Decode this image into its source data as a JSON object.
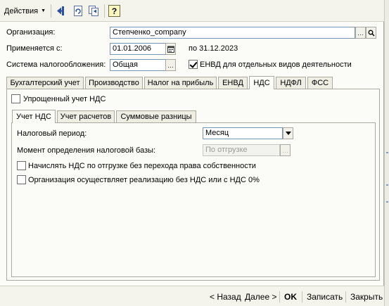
{
  "toolbar": {
    "actions_label": "Действия",
    "icons": [
      "back-arrow-icon",
      "refresh-doc-icon",
      "copy-forward-icon",
      "help-icon"
    ],
    "help_glyph": "?"
  },
  "form": {
    "organization": {
      "label": "Организация:",
      "value": "Степченко_company"
    },
    "applies_from": {
      "label": "Применяется с:",
      "value": "01.01.2006",
      "to_text": "по 31.12.2023"
    },
    "tax_system": {
      "label": "Система налогообложения:",
      "value": "Общая"
    },
    "envd_checkbox": {
      "label": "ЕНВД для отдельных видов деятельности",
      "checked": true
    }
  },
  "tabs": [
    {
      "label": "Бухгалтерский учет",
      "active": false
    },
    {
      "label": "Производство",
      "active": false
    },
    {
      "label": "Налог на прибыль",
      "active": false
    },
    {
      "label": "ЕНВД",
      "active": false
    },
    {
      "label": "НДС",
      "active": true
    },
    {
      "label": "НДФЛ",
      "active": false
    },
    {
      "label": "ФСС",
      "active": false
    }
  ],
  "vat": {
    "simplified_checkbox": {
      "label": "Упрощенный учет НДС",
      "checked": false
    },
    "subtabs": [
      {
        "label": "Учет НДС",
        "active": true
      },
      {
        "label": "Учет расчетов",
        "active": false
      },
      {
        "label": "Суммовые разницы",
        "active": false
      }
    ],
    "tax_period": {
      "label": "Налоговый период:",
      "value": "Месяц"
    },
    "tax_base_moment": {
      "label": "Момент определения налоговой базы:",
      "value": "По отгрузке"
    },
    "charge_vat_checkbox": {
      "label": "Начислять НДС по отгрузке без перехода права собственности",
      "checked": false
    },
    "no_vat_checkbox": {
      "label": "Организация осуществляет реализацию без НДС или с НДС 0%",
      "checked": false
    }
  },
  "bottom": {
    "back": "< Назад",
    "next": "Далее >",
    "ok": "OK",
    "save": "Записать",
    "close": "Закрыть"
  }
}
